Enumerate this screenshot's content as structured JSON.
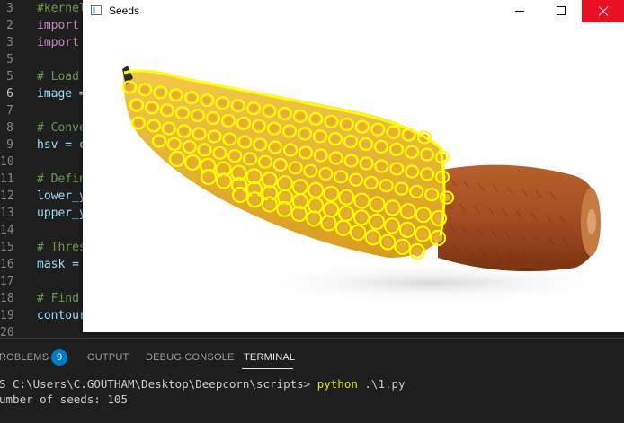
{
  "editor": {
    "active_line": "6",
    "lines": [
      {
        "num": "3",
        "code": "#kernel"
      },
      {
        "num": "2",
        "code": "import"
      },
      {
        "num": "3",
        "code": "import"
      },
      {
        "num": "5",
        "code": ""
      },
      {
        "num": "5",
        "code": "# Load"
      },
      {
        "num": "6",
        "code": "image ="
      },
      {
        "num": "7",
        "code": ""
      },
      {
        "num": "8",
        "code": "# Conve"
      },
      {
        "num": "9",
        "code": "hsv = c"
      },
      {
        "num": "10",
        "code": ""
      },
      {
        "num": "11",
        "code": "# Defin"
      },
      {
        "num": "12",
        "code": "lower_y"
      },
      {
        "num": "13",
        "code": "upper_y"
      },
      {
        "num": "14",
        "code": ""
      },
      {
        "num": "15",
        "code": "# Thres"
      },
      {
        "num": "16",
        "code": "mask ="
      },
      {
        "num": "17",
        "code": ""
      },
      {
        "num": "18",
        "code": "# Find"
      },
      {
        "num": "19",
        "code": "contour"
      },
      {
        "num": "20",
        "code": ""
      }
    ]
  },
  "seeds_window": {
    "title": "Seeds",
    "icon": "app-window-icon",
    "close_color": "#e81123",
    "image": {
      "subject": "corn cob with yellow seed contours",
      "contour_color": "#ffff00"
    }
  },
  "panel": {
    "tabs": [
      {
        "label": "ROBLEMS",
        "badge": "9"
      },
      {
        "label": "OUTPUT"
      },
      {
        "label": "DEBUG CONSOLE"
      },
      {
        "label": "TERMINAL",
        "active": true
      }
    ],
    "terminal": {
      "prompt": "S C:\\Users\\C.GOUTHAM\\Desktop\\Deepcorn\\scripts>",
      "command": "python",
      "argument": ".\\1.py",
      "output": "umber of seeds: 105"
    }
  },
  "colors": {
    "editor_bg": "#1e1e1e",
    "comment": "#6a9955",
    "keyword": "#c586c0",
    "variable": "#9cdcfe",
    "badge": "#007acc",
    "terminal_command": "#e5e510"
  }
}
